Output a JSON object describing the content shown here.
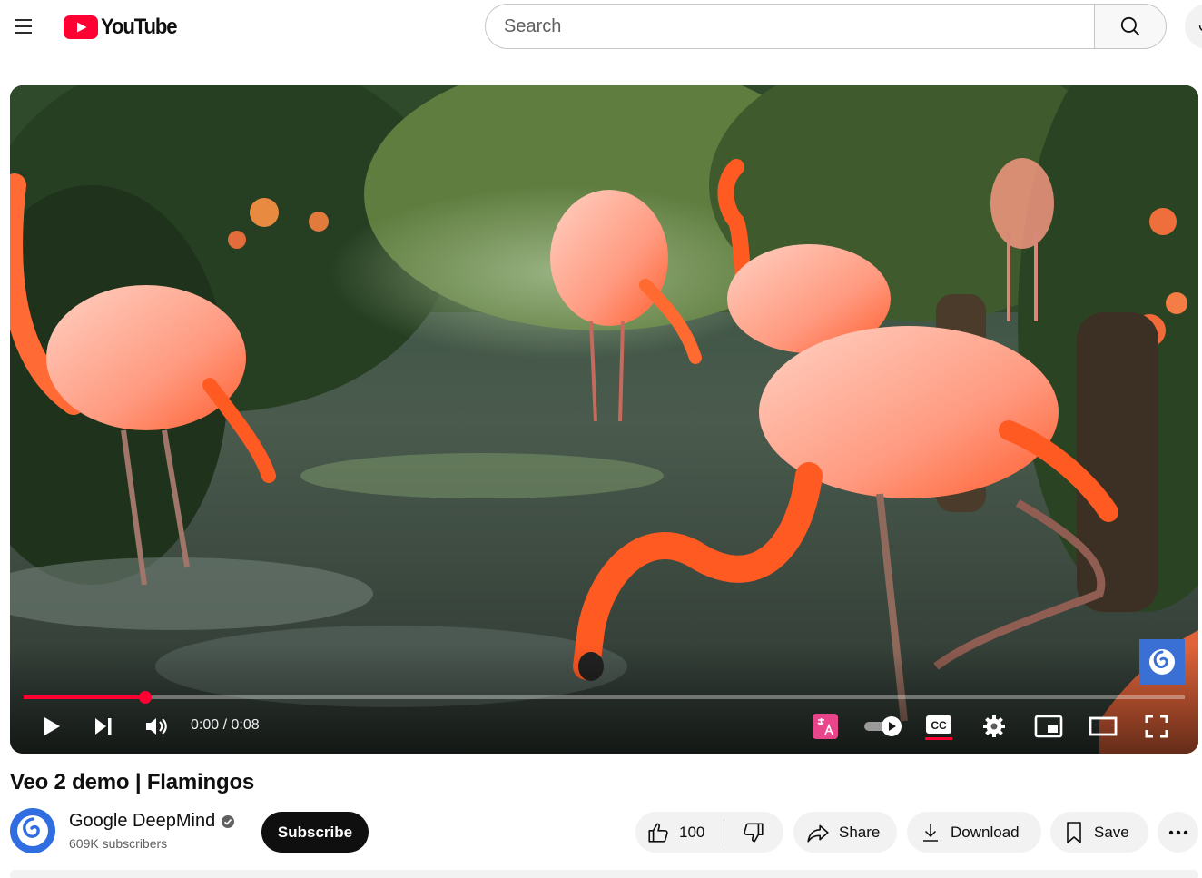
{
  "masthead": {
    "logo_text": "YouTube",
    "search_placeholder": "Search"
  },
  "player": {
    "time_display": "0:00 / 0:08",
    "progress_fraction": 0.105,
    "accent_color": "#ff0033"
  },
  "video": {
    "title": "Veo 2 demo | Flamingos"
  },
  "channel": {
    "name": "Google DeepMind",
    "subscribers": "609K subscribers",
    "subscribe_label": "Subscribe"
  },
  "actions": {
    "like_count": "100",
    "share_label": "Share",
    "download_label": "Download",
    "save_label": "Save"
  },
  "icons": [
    "menu-icon",
    "youtube-logo-icon",
    "search-icon",
    "microphone-icon",
    "play-icon",
    "next-icon",
    "volume-icon",
    "auto-translate-icon",
    "autoplay-toggle",
    "captions-icon",
    "settings-icon",
    "miniplayer-icon",
    "theater-mode-icon",
    "fullscreen-icon",
    "verified-icon",
    "like-icon",
    "dislike-icon",
    "share-icon",
    "download-icon",
    "save-icon",
    "more-icon"
  ]
}
